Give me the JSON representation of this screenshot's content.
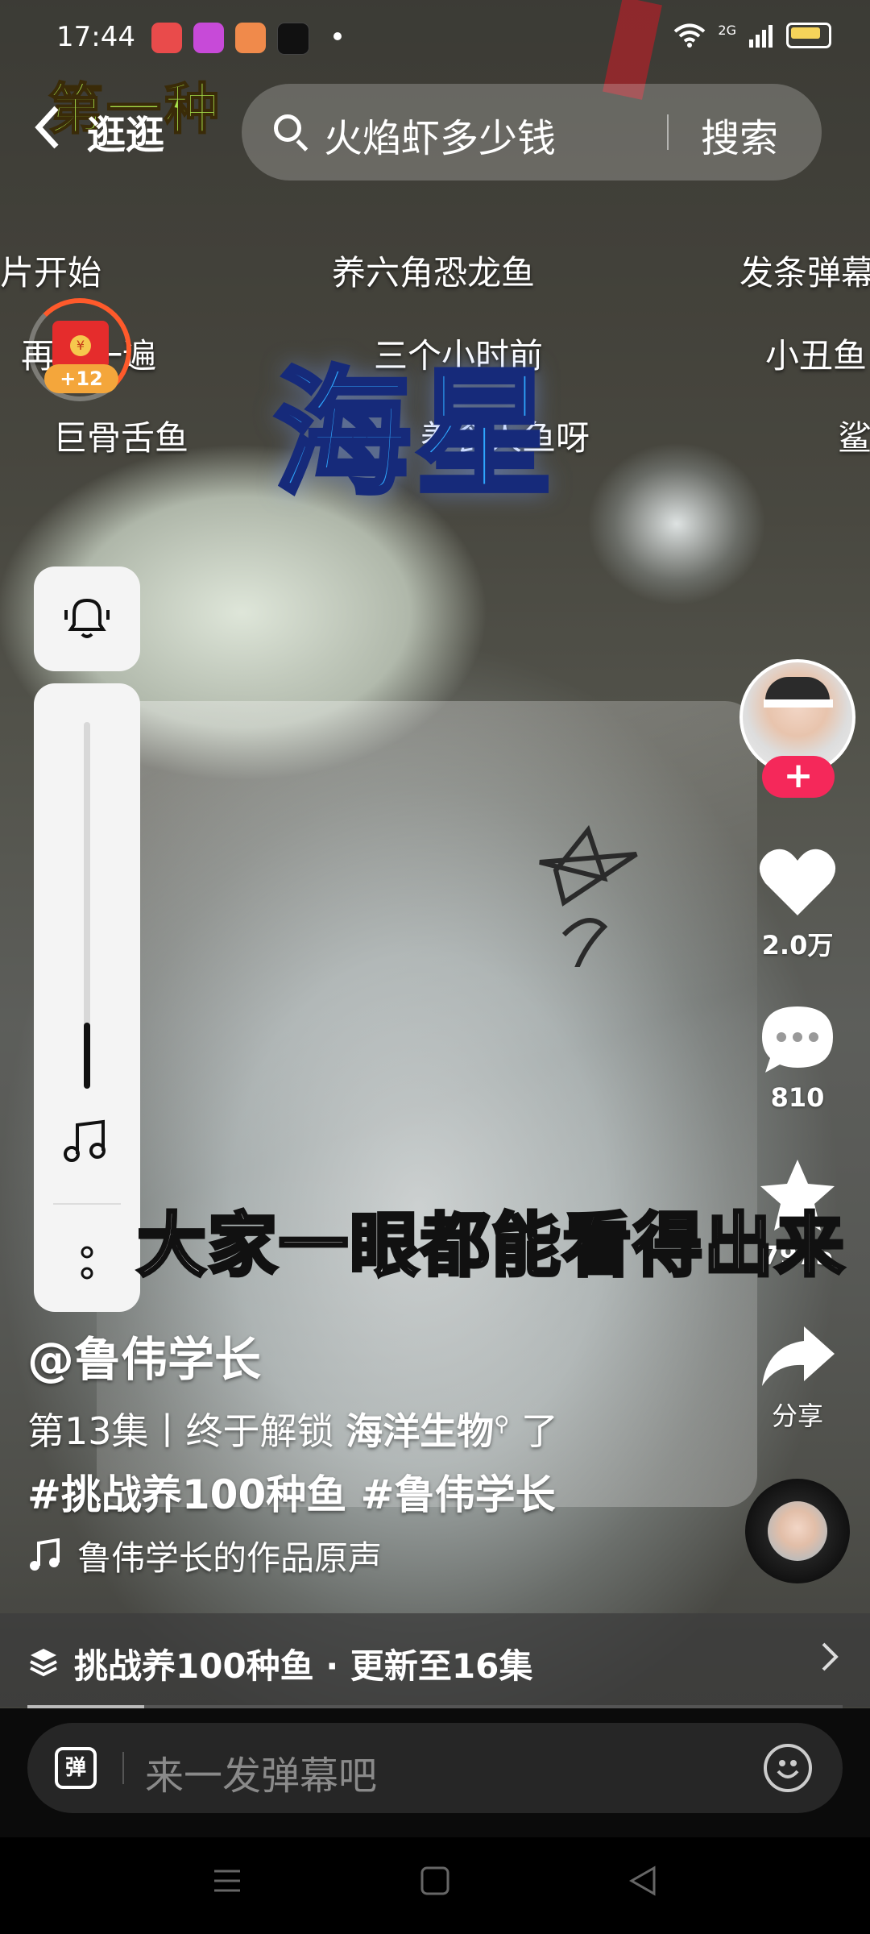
{
  "status_bar": {
    "time": "17:44",
    "network": "2G"
  },
  "top_bar": {
    "back_label": "逛逛",
    "overlay_title": "第一种",
    "search_query": "火焰虾多少钱",
    "search_button": "搜索"
  },
  "danmaku": [
    "片开始",
    "养六角恐龙鱼",
    "发条弹幕",
    "再看一遍",
    "三个小时前",
    "小丑鱼",
    "巨骨舌鱼",
    "养食人鱼呀",
    "鲨"
  ],
  "red_packet": {
    "badge": "+12",
    "coin": "¥"
  },
  "video": {
    "big_title": "海星",
    "subtitle": "大家一眼都能看得出来"
  },
  "side_panel": {
    "volume_level": 0.18
  },
  "actions": {
    "likes": "2.0万",
    "comments": "810",
    "favorites": "7975",
    "share": "分享",
    "follow_symbol": "+"
  },
  "post": {
    "author": "@鲁伟学长",
    "desc_prefix": "第13集丨终于解锁 ",
    "desc_link": "海洋生物",
    "desc_suffix": " 了",
    "hashtags": "#挑战养100种鱼 #鲁伟学长",
    "music": "鲁伟学长的作品原声"
  },
  "series": {
    "label": "挑战养100种鱼 · 更新至16集"
  },
  "comment_input": {
    "danmaku_icon": "弹",
    "placeholder": "来一发弹幕吧"
  },
  "colors": {
    "follow": "#f5285a",
    "title_blue": "#2ea7ff",
    "title_green": "#a6e04a",
    "battery": "#f5d35a"
  }
}
